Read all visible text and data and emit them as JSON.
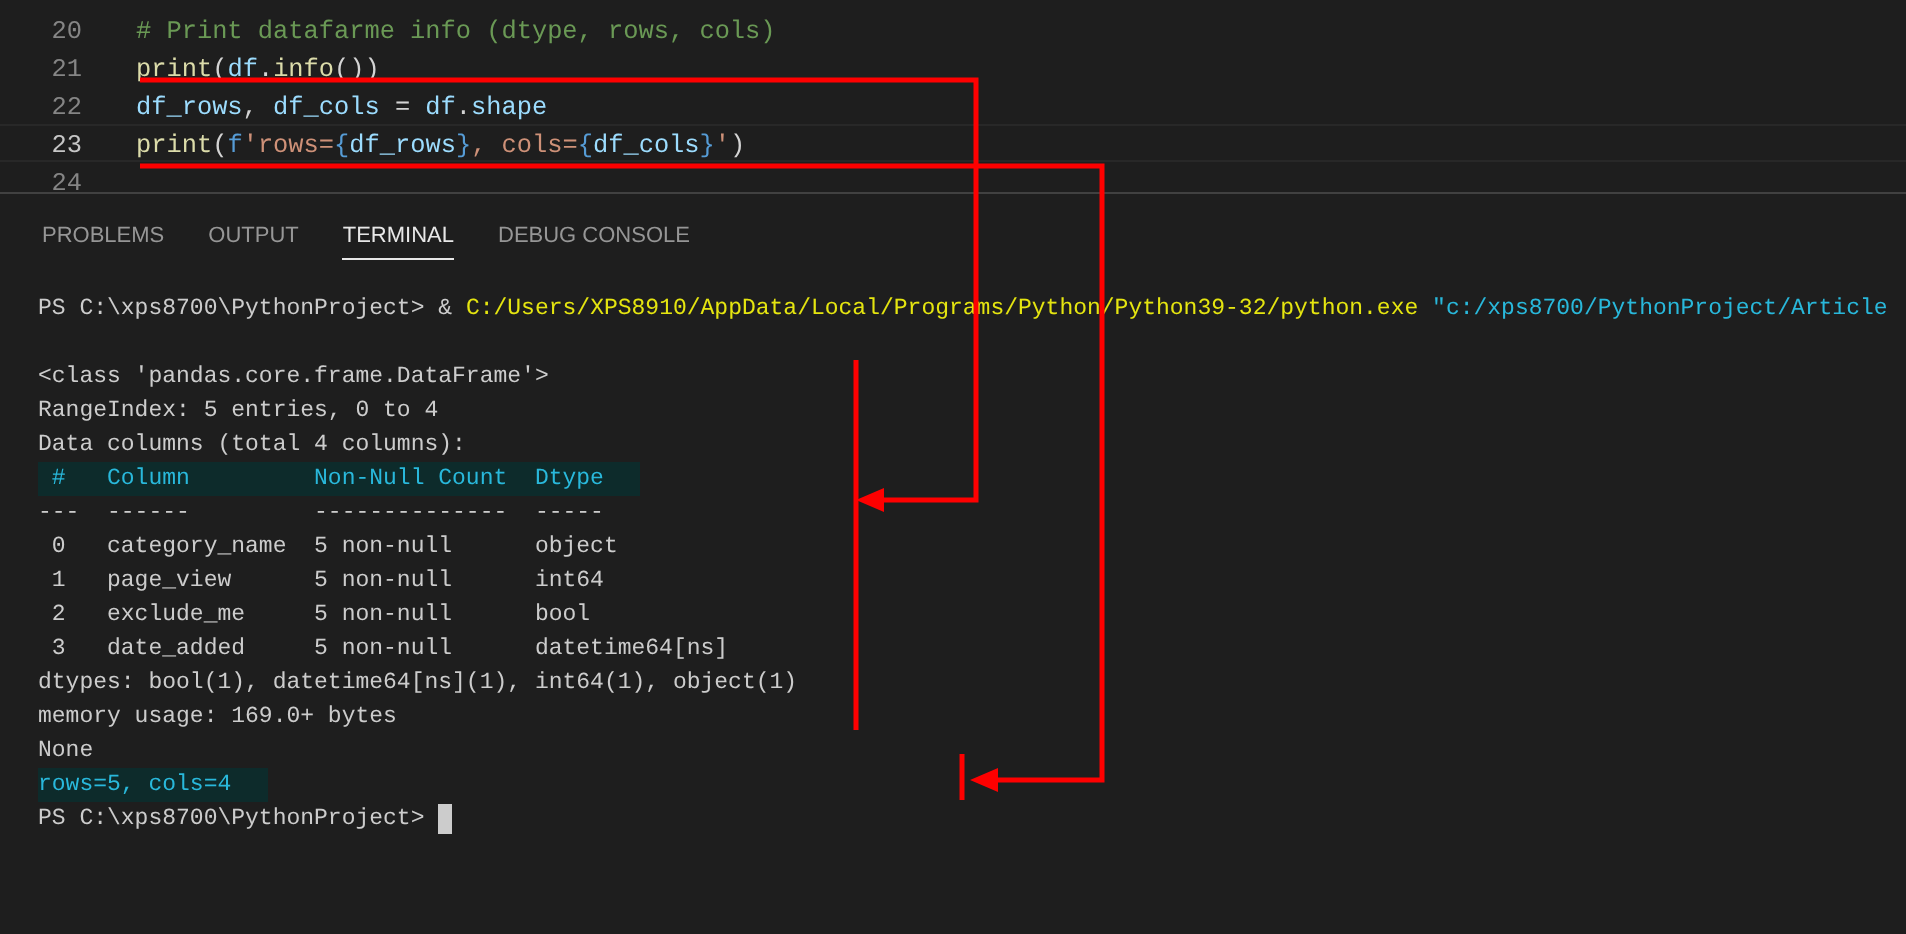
{
  "editor": {
    "lines": [
      {
        "number": "20",
        "current": false,
        "tokens": [
          {
            "kind": "comment",
            "text": "# Print datafarme info (dtype, rows, cols)"
          }
        ]
      },
      {
        "number": "21",
        "current": false,
        "tokens": [
          {
            "kind": "function",
            "text": "print"
          },
          {
            "kind": "punct",
            "text": "("
          },
          {
            "kind": "variable",
            "text": "df"
          },
          {
            "kind": "punct",
            "text": "."
          },
          {
            "kind": "function",
            "text": "info"
          },
          {
            "kind": "punct",
            "text": "())"
          }
        ]
      },
      {
        "number": "22",
        "current": false,
        "tokens": [
          {
            "kind": "variable",
            "text": "df_rows"
          },
          {
            "kind": "punct",
            "text": ", "
          },
          {
            "kind": "variable",
            "text": "df_cols"
          },
          {
            "kind": "punct",
            "text": " = "
          },
          {
            "kind": "variable",
            "text": "df"
          },
          {
            "kind": "punct",
            "text": "."
          },
          {
            "kind": "variable",
            "text": "shape"
          }
        ]
      },
      {
        "number": "23",
        "current": true,
        "tokens": [
          {
            "kind": "function",
            "text": "print"
          },
          {
            "kind": "punct",
            "text": "("
          },
          {
            "kind": "keyword",
            "text": "f"
          },
          {
            "kind": "string",
            "text": "'rows="
          },
          {
            "kind": "keyword",
            "text": "{"
          },
          {
            "kind": "variable",
            "text": "df_rows"
          },
          {
            "kind": "keyword",
            "text": "}"
          },
          {
            "kind": "string",
            "text": ", cols="
          },
          {
            "kind": "keyword",
            "text": "{"
          },
          {
            "kind": "variable",
            "text": "df_cols"
          },
          {
            "kind": "keyword",
            "text": "}"
          },
          {
            "kind": "string",
            "text": "'"
          },
          {
            "kind": "punct",
            "text": ")"
          }
        ]
      },
      {
        "number": "24",
        "current": false
      }
    ]
  },
  "panel": {
    "tabs": [
      {
        "label": "PROBLEMS",
        "selected": false
      },
      {
        "label": "OUTPUT",
        "selected": false
      },
      {
        "label": "TERMINAL",
        "selected": true
      },
      {
        "label": "DEBUG CONSOLE",
        "selected": false
      }
    ]
  },
  "terminal": {
    "lines": [
      {
        "kind": "command",
        "prompt": "PS C:\\xps8700\\PythonProject> ",
        "operator": "& ",
        "path": "C:/Users/XPS8910/AppData/Local/Programs/Python/Python39-32/python.exe ",
        "argument": "\"c:/xps8700/PythonProject/Article"
      },
      {
        "kind": "output",
        "text": "<class 'pandas.core.frame.DataFrame'>"
      },
      {
        "kind": "output",
        "text": "RangeIndex: 5 entries, 0 to 4"
      },
      {
        "kind": "output",
        "text": "Data columns (total 4 columns):"
      },
      {
        "kind": "highlight",
        "text": " #   Column         Non-Null Count  Dtype"
      },
      {
        "kind": "output",
        "text": "---  ------         --------------  -----"
      },
      {
        "kind": "output",
        "text": " 0   category_name  5 non-null      object"
      },
      {
        "kind": "output",
        "text": " 1   page_view      5 non-null      int64"
      },
      {
        "kind": "output",
        "text": " 2   exclude_me     5 non-null      bool"
      },
      {
        "kind": "output",
        "text": " 3   date_added     5 non-null      datetime64[ns]"
      },
      {
        "kind": "output",
        "text": "dtypes: bool(1), datetime64[ns](1), int64(1), object(1)"
      },
      {
        "kind": "output",
        "text": "memory usage: 169.0+ bytes"
      },
      {
        "kind": "output",
        "text": "None"
      },
      {
        "kind": "highlight",
        "text": "rows=5, cols=4"
      },
      {
        "kind": "prompt",
        "prompt": "PS C:\\xps8700\\PythonProject> ",
        "cursor": true
      }
    ]
  }
}
